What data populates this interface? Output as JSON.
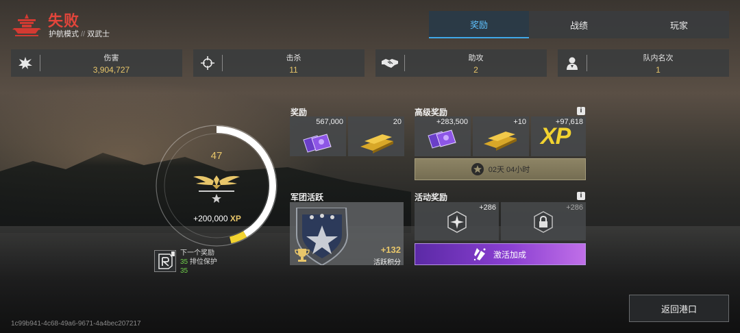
{
  "header": {
    "result": "失败",
    "mode": "护航模式",
    "separator": "//",
    "submode": "双武士"
  },
  "tabs": [
    {
      "label": "奖励",
      "active": true
    },
    {
      "label": "战绩",
      "active": false
    },
    {
      "label": "玩家",
      "active": false
    }
  ],
  "stats": [
    {
      "label": "伤害",
      "value": "3,904,727",
      "icon": "explosion-icon"
    },
    {
      "label": "击杀",
      "value": "11",
      "icon": "crosshair-icon"
    },
    {
      "label": "助攻",
      "value": "2",
      "icon": "handshake-icon"
    },
    {
      "label": "队内名次",
      "value": "1",
      "icon": "rank-person-icon"
    }
  ],
  "progress": {
    "level": "47",
    "xp_value": "+200,000",
    "xp_word": "XP",
    "fill_fraction": 0.46
  },
  "next_reward": {
    "title": "下一个奖励",
    "line1_num": "35",
    "line1_text": "排位保护",
    "line2_num": "35"
  },
  "rewards": {
    "title": "奖励",
    "items": [
      {
        "count": "567,000",
        "icon": "credits-icon"
      },
      {
        "count": "20",
        "icon": "gold-bars-icon"
      }
    ]
  },
  "premium": {
    "title": "高级奖励",
    "info": "i",
    "items": [
      {
        "count": "+283,500",
        "icon": "credits-icon"
      },
      {
        "count": "+10",
        "icon": "gold-bars-icon"
      },
      {
        "count": "+97,618",
        "icon": "xp-icon",
        "icon_text": "XP"
      }
    ],
    "timer": "02天 04小时"
  },
  "legion": {
    "title": "军团活跃",
    "value": "+132",
    "label": "活跃积分"
  },
  "event": {
    "title": "活动奖励",
    "info": "i",
    "items": [
      {
        "count": "+286",
        "icon": "compass-badge-icon"
      },
      {
        "count": "+286",
        "icon": "lock-badge-icon"
      }
    ],
    "activate": "激活加成"
  },
  "footer": {
    "back": "返回港口",
    "match_id": "1c99b941-4c68-49a6-9671-4a4bec207217"
  },
  "colors": {
    "defeat": "#e2453b",
    "tab_active": "#5fc2ff",
    "value_gold": "#e8c66a",
    "xp_yellow": "#f2d330",
    "green": "#6fcf4a"
  }
}
